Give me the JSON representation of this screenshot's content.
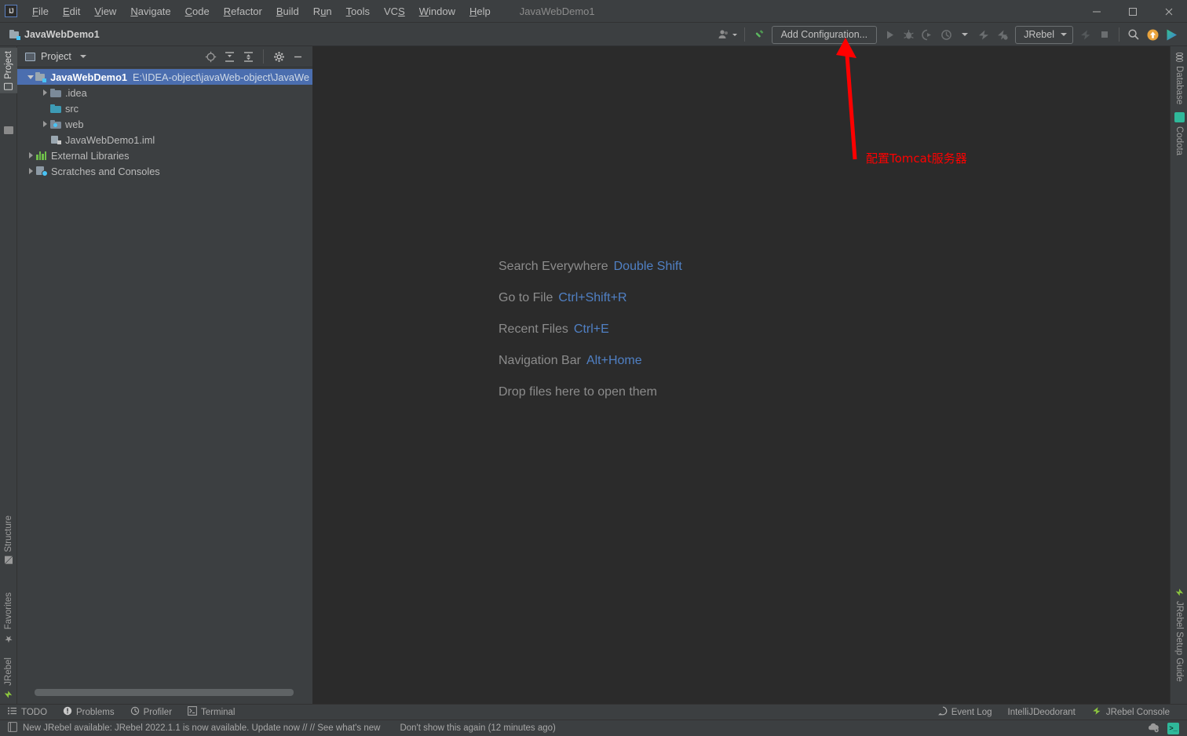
{
  "window": {
    "title": "JavaWebDemo1",
    "minimize": "—",
    "maximize": "☐",
    "close": "×"
  },
  "menubar": {
    "items": [
      {
        "label": "File",
        "mnemonic": "F"
      },
      {
        "label": "Edit",
        "mnemonic": "E"
      },
      {
        "label": "View",
        "mnemonic": "V"
      },
      {
        "label": "Navigate",
        "mnemonic": "N"
      },
      {
        "label": "Code",
        "mnemonic": "C"
      },
      {
        "label": "Refactor",
        "mnemonic": "R"
      },
      {
        "label": "Build",
        "mnemonic": "B"
      },
      {
        "label": "Run",
        "mnemonic": "u"
      },
      {
        "label": "Tools",
        "mnemonic": "T"
      },
      {
        "label": "VCS",
        "mnemonic": "S"
      },
      {
        "label": "Window",
        "mnemonic": "W"
      },
      {
        "label": "Help",
        "mnemonic": "H"
      }
    ]
  },
  "toolbar": {
    "project_crumb": "JavaWebDemo1",
    "add_configuration_label": "Add Configuration...",
    "jrebel_label": "JRebel",
    "icons": {
      "user": "user-icon",
      "build": "build-hammer-icon",
      "run": "run-icon",
      "debug": "debug-icon",
      "run_coverage": "run-with-coverage-icon",
      "profile": "profile-icon",
      "jrebel_run": "jrebel-run-icon",
      "jrebel_debug": "jrebel-debug-icon",
      "jrebel_deploy": "jrebel-deploy-icon",
      "stop": "stop-icon",
      "search": "search-icon",
      "update": "update-available-icon",
      "codota": "codota-icon"
    }
  },
  "left_rail": {
    "top": [
      {
        "label": "Project",
        "icon": "project-icon",
        "selected": true
      },
      {
        "label": "",
        "icon": "folder-icon",
        "selected": false
      }
    ],
    "bottom": [
      {
        "label": "Structure",
        "icon": "structure-icon"
      },
      {
        "label": "Favorites",
        "icon": "star-icon"
      },
      {
        "label": "JRebel",
        "icon": "jrebel-icon"
      }
    ]
  },
  "right_rail": {
    "top": [
      {
        "label": "Database",
        "icon": "database-icon"
      },
      {
        "label": "Codota",
        "icon": "codota-icon"
      }
    ],
    "bottom": [
      {
        "label": "JRebel Setup Guide",
        "icon": "jrebel-icon"
      }
    ]
  },
  "project_panel": {
    "title": "Project",
    "header_icons": [
      {
        "name": "select-opened-file-icon"
      },
      {
        "name": "expand-all-icon"
      },
      {
        "name": "collapse-all-icon"
      },
      {
        "name": "settings-gear-icon"
      },
      {
        "name": "hide-icon"
      }
    ],
    "tree": [
      {
        "depth": 0,
        "arrow": "down",
        "icon": "module-icon",
        "name": "JavaWebDemo1",
        "path": "E:\\IDEA-object\\javaWeb-object\\JavaWe",
        "selected": true,
        "bold": true
      },
      {
        "depth": 1,
        "arrow": "right",
        "icon": "folder-icon",
        "name": ".idea",
        "path": "",
        "selected": false,
        "bold": false
      },
      {
        "depth": 1,
        "arrow": "none",
        "icon": "source-folder-icon",
        "name": "src",
        "path": "",
        "selected": false,
        "bold": false
      },
      {
        "depth": 1,
        "arrow": "right",
        "icon": "web-folder-icon",
        "name": "web",
        "path": "",
        "selected": false,
        "bold": false
      },
      {
        "depth": 1,
        "arrow": "none",
        "icon": "iml-file-icon",
        "name": "JavaWebDemo1.iml",
        "path": "",
        "selected": false,
        "bold": false
      },
      {
        "depth": 0,
        "arrow": "right",
        "icon": "libraries-icon",
        "name": "External Libraries",
        "path": "",
        "selected": false,
        "bold": false
      },
      {
        "depth": 0,
        "arrow": "right",
        "icon": "scratches-icon",
        "name": "Scratches and Consoles",
        "path": "",
        "selected": false,
        "bold": false
      }
    ]
  },
  "editor": {
    "hints": [
      {
        "action": "Search Everywhere",
        "shortcut": "Double Shift"
      },
      {
        "action": "Go to File",
        "shortcut": "Ctrl+Shift+R"
      },
      {
        "action": "Recent Files",
        "shortcut": "Ctrl+E"
      },
      {
        "action": "Navigation Bar",
        "shortcut": "Alt+Home"
      },
      {
        "action": "Drop files here to open them",
        "shortcut": ""
      }
    ]
  },
  "annotation": {
    "text": "配置Tomcat服务器",
    "color": "#ff0000"
  },
  "bottom_tabs": [
    {
      "label": "TODO",
      "icon": "todo-icon"
    },
    {
      "label": "Problems",
      "icon": "problems-icon"
    },
    {
      "label": "Profiler",
      "icon": "profiler-icon"
    },
    {
      "label": "Terminal",
      "icon": "terminal-icon"
    }
  ],
  "bottom_tabs_right": [
    {
      "label": "Event Log",
      "icon": "event-log-icon"
    },
    {
      "label": "IntelliJDeodorant",
      "icon": ""
    },
    {
      "label": "JRebel Console",
      "icon": "jrebel-icon"
    }
  ],
  "statusbar": {
    "message": "New JRebel available: JRebel 2022.1.1 is now available. Update now // // See what's new",
    "dismiss": "Don't show this again (12 minutes ago)",
    "icons": [
      "cloud-settings-icon",
      "terminal-icon"
    ]
  },
  "colors": {
    "panel_bg": "#3c3f41",
    "editor_bg": "#2b2b2b",
    "selection_blue": "#4b6eaf",
    "link_blue": "#5080c4",
    "annotation_red": "#ff0000",
    "text": "#bbbbbb"
  }
}
